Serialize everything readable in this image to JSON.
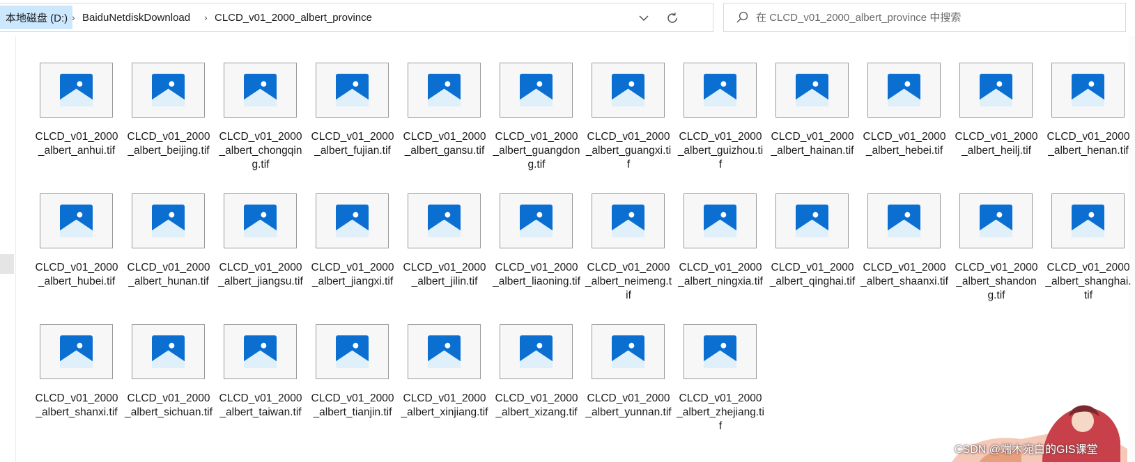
{
  "address_bar": {
    "root_label": "本地磁盘 (D:)",
    "crumbs": [
      "BaiduNetdiskDownload",
      "CLCD_v01_2000_albert_province"
    ],
    "separator": "›"
  },
  "search": {
    "placeholder": "在 CLCD_v01_2000_albert_province 中搜索",
    "value": ""
  },
  "files": [
    "CLCD_v01_2000_albert_anhui.tif",
    "CLCD_v01_2000_albert_beijing.tif",
    "CLCD_v01_2000_albert_chongqing.tif",
    "CLCD_v01_2000_albert_fujian.tif",
    "CLCD_v01_2000_albert_gansu.tif",
    "CLCD_v01_2000_albert_guangdong.tif",
    "CLCD_v01_2000_albert_guangxi.tif",
    "CLCD_v01_2000_albert_guizhou.tif",
    "CLCD_v01_2000_albert_hainan.tif",
    "CLCD_v01_2000_albert_hebei.tif",
    "CLCD_v01_2000_albert_heilj.tif",
    "CLCD_v01_2000_albert_henan.tif",
    "CLCD_v01_2000_albert_hubei.tif",
    "CLCD_v01_2000_albert_hunan.tif",
    "CLCD_v01_2000_albert_jiangsu.tif",
    "CLCD_v01_2000_albert_jiangxi.tif",
    "CLCD_v01_2000_albert_jilin.tif",
    "CLCD_v01_2000_albert_liaoning.tif",
    "CLCD_v01_2000_albert_neimeng.tif",
    "CLCD_v01_2000_albert_ningxia.tif",
    "CLCD_v01_2000_albert_qinghai.tif",
    "CLCD_v01_2000_albert_shaanxi.tif",
    "CLCD_v01_2000_albert_shandong.tif",
    "CLCD_v01_2000_albert_shanghai.tif",
    "CLCD_v01_2000_albert_shanxi.tif",
    "CLCD_v01_2000_albert_sichuan.tif",
    "CLCD_v01_2000_albert_taiwan.tif",
    "CLCD_v01_2000_albert_tianjin.tif",
    "CLCD_v01_2000_albert_xinjiang.tif",
    "CLCD_v01_2000_albert_xizang.tif",
    "CLCD_v01_2000_albert_yunnan.tif",
    "CLCD_v01_2000_albert_zhejiang.tif"
  ],
  "file_icon": "image-file-icon",
  "watermark": {
    "text": "CSDN @端木宛白的GIS课堂"
  },
  "colors": {
    "selected_crumb_bg": "#cce8ff",
    "icon_blue": "#0a6fd1",
    "icon_mountain": "#dff0fb"
  }
}
